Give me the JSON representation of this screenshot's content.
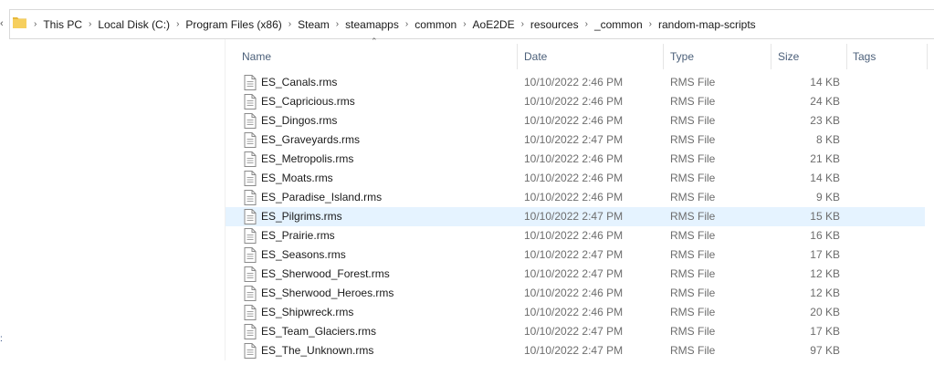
{
  "breadcrumb": [
    "This PC",
    "Local Disk (C:)",
    "Program Files (x86)",
    "Steam",
    "steamapps",
    "common",
    "AoE2DE",
    "resources",
    "_common",
    "random-map-scripts"
  ],
  "columns": {
    "name": "Name",
    "date": "Date",
    "type": "Type",
    "size": "Size",
    "tags": "Tags"
  },
  "files": [
    {
      "name": "ES_Canals.rms",
      "date": "10/10/2022 2:46 PM",
      "type": "RMS File",
      "size": "14 KB"
    },
    {
      "name": "ES_Capricious.rms",
      "date": "10/10/2022 2:46 PM",
      "type": "RMS File",
      "size": "24 KB"
    },
    {
      "name": "ES_Dingos.rms",
      "date": "10/10/2022 2:46 PM",
      "type": "RMS File",
      "size": "23 KB"
    },
    {
      "name": "ES_Graveyards.rms",
      "date": "10/10/2022 2:47 PM",
      "type": "RMS File",
      "size": "8 KB"
    },
    {
      "name": "ES_Metropolis.rms",
      "date": "10/10/2022 2:46 PM",
      "type": "RMS File",
      "size": "21 KB"
    },
    {
      "name": "ES_Moats.rms",
      "date": "10/10/2022 2:46 PM",
      "type": "RMS File",
      "size": "14 KB"
    },
    {
      "name": "ES_Paradise_Island.rms",
      "date": "10/10/2022 2:46 PM",
      "type": "RMS File",
      "size": "9 KB"
    },
    {
      "name": "ES_Pilgrims.rms",
      "date": "10/10/2022 2:47 PM",
      "type": "RMS File",
      "size": "15 KB",
      "selected": true
    },
    {
      "name": "ES_Prairie.rms",
      "date": "10/10/2022 2:46 PM",
      "type": "RMS File",
      "size": "16 KB"
    },
    {
      "name": "ES_Seasons.rms",
      "date": "10/10/2022 2:47 PM",
      "type": "RMS File",
      "size": "17 KB"
    },
    {
      "name": "ES_Sherwood_Forest.rms",
      "date": "10/10/2022 2:47 PM",
      "type": "RMS File",
      "size": "12 KB"
    },
    {
      "name": "ES_Sherwood_Heroes.rms",
      "date": "10/10/2022 2:46 PM",
      "type": "RMS File",
      "size": "12 KB"
    },
    {
      "name": "ES_Shipwreck.rms",
      "date": "10/10/2022 2:46 PM",
      "type": "RMS File",
      "size": "20 KB"
    },
    {
      "name": "ES_Team_Glaciers.rms",
      "date": "10/10/2022 2:47 PM",
      "type": "RMS File",
      "size": "17 KB"
    },
    {
      "name": "ES_The_Unknown.rms",
      "date": "10/10/2022 2:47 PM",
      "type": "RMS File",
      "size": "97 KB"
    }
  ],
  "icons": {
    "folder": "folder-icon",
    "file": "document-icon",
    "chevron": "chevron-right-icon",
    "sort": "sort-up-icon"
  },
  "colors": {
    "selection": "#e5f3ff",
    "folder": "#f2c14e",
    "header_text": "#4c607a"
  }
}
